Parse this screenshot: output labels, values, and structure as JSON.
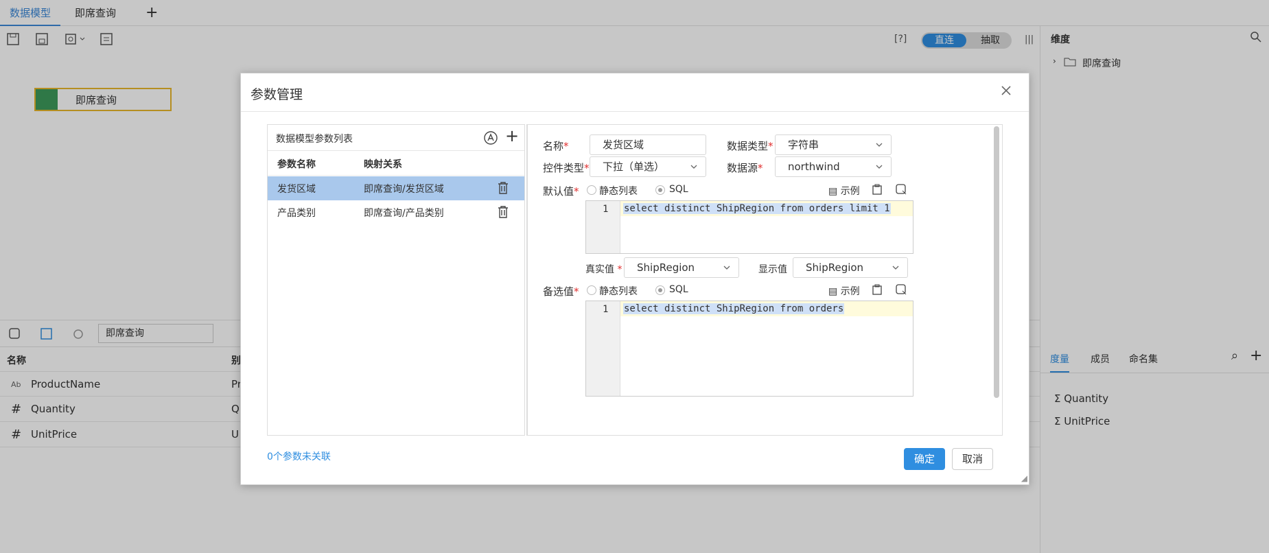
{
  "tabs": [
    {
      "label": "数据模型"
    },
    {
      "label": "即席查询"
    }
  ],
  "toolbar": {
    "help": "[?]",
    "direct": "直连",
    "extract": "抽取"
  },
  "canvas": {
    "node_label": "即席查询"
  },
  "bottom": {
    "search_value": "即席查询",
    "col_name": "名称",
    "col_alias": "别",
    "rows": [
      {
        "type": "Ab",
        "name": "ProductName",
        "alias": "Pr"
      },
      {
        "type": "#",
        "name": "Quantity",
        "alias": "Q"
      },
      {
        "type": "#",
        "name": "UnitPrice",
        "alias": "U"
      }
    ]
  },
  "right_panel": {
    "dimension_title": "维度",
    "tree_item": "即席查询",
    "tabs": [
      "度量",
      "成员",
      "命名集"
    ],
    "measures": [
      "Quantity",
      "UnitPrice"
    ]
  },
  "dialog": {
    "title": "参数管理",
    "list_title": "数据模型参数列表",
    "col_param": "参数名称",
    "col_map": "映射关系",
    "params": [
      {
        "name": "发货区域",
        "map": "即席查询/发货区域"
      },
      {
        "name": "产品类别",
        "map": "即席查询/产品类别"
      }
    ],
    "labels": {
      "name": "名称",
      "data_type": "数据类型",
      "control_type": "控件类型",
      "datasource": "数据源",
      "default": "默认值",
      "real_value": "真实值",
      "display_value": "显示值",
      "options": "备选值",
      "static_list": "静态列表",
      "sql": "SQL",
      "example": "示例"
    },
    "values": {
      "name": "发货区域",
      "data_type": "字符串",
      "control_type": "下拉（单选）",
      "datasource": "northwind",
      "real_value": "ShipRegion",
      "display_value": "ShipRegion"
    },
    "default_sql_line": "1",
    "default_sql": "select distinct ShipRegion from orders limit 1",
    "options_sql_line": "1",
    "options_sql": "select distinct ShipRegion from orders",
    "unlinked": "0个参数未关联",
    "ok": "确定",
    "cancel": "取消",
    "accent": "#2f8ee0"
  }
}
